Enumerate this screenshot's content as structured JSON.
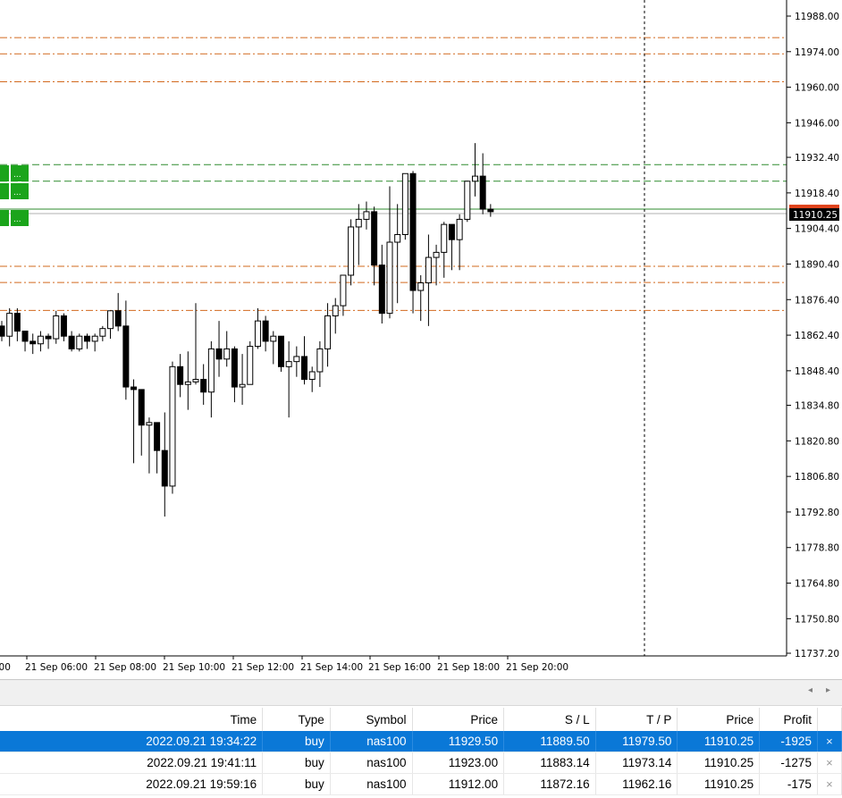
{
  "chart": {
    "price_axis": {
      "labels": [
        "11988.00",
        "11974.00",
        "11960.00",
        "11946.00",
        "11932.40",
        "11918.40",
        "11904.40",
        "11890.40",
        "11876.40",
        "11862.40",
        "11848.40",
        "11834.80",
        "11820.80",
        "11806.80",
        "11792.80",
        "11778.80",
        "11764.80",
        "11750.80",
        "11737.20"
      ],
      "min": 11737.2,
      "max": 11988.0
    },
    "time_axis": {
      "labels": [
        ":00",
        "21 Sep 06:00",
        "21 Sep 08:00",
        "21 Sep 10:00",
        "21 Sep 12:00",
        "21 Sep 14:00",
        "21 Sep 16:00",
        "21 Sep 18:00",
        "21 Sep 20:00"
      ]
    },
    "bid_price_tag": "11910.25",
    "bid_price": 11910.25,
    "entry_lines": [
      11929.5,
      11923.0,
      11912.0
    ],
    "sl_lines": [
      11889.5,
      11883.14,
      11872.16
    ],
    "tp_lines": [
      11979.5,
      11973.14,
      11962.16
    ],
    "colors": {
      "entry_line": "#2e8b2e",
      "stop_loss_line": "#d2691e",
      "take_profit_line": "#d2691e",
      "bid_tag_bg": "#000000",
      "bull_candle": "#ffffff",
      "bear_candle": "#000000",
      "trade_button": "#1ba41b",
      "selected_row": "#0a78d7"
    },
    "trade_buttons": [
      "...",
      "...",
      "..."
    ],
    "candles": [
      [
        11866,
        11868,
        11860,
        11862
      ],
      [
        11862,
        11873,
        11858,
        11871
      ],
      [
        11871,
        11873,
        11860,
        11864
      ],
      [
        11864,
        11864,
        11856,
        11860
      ],
      [
        11860,
        11863,
        11855,
        11859
      ],
      [
        11859,
        11864,
        11856,
        11862
      ],
      [
        11862,
        11863,
        11857,
        11861
      ],
      [
        11861,
        11872,
        11859,
        11870
      ],
      [
        11870,
        11871,
        11860,
        11862
      ],
      [
        11862,
        11864,
        11856,
        11857
      ],
      [
        11857,
        11863,
        11856,
        11862
      ],
      [
        11862,
        11863,
        11857,
        11860
      ],
      [
        11860,
        11863,
        11856,
        11862
      ],
      [
        11862,
        11866,
        11860,
        11865
      ],
      [
        11865,
        11872,
        11861,
        11872
      ],
      [
        11872,
        11879,
        11864,
        11866
      ],
      [
        11866,
        11876,
        11837,
        11842
      ],
      [
        11842,
        11845,
        11812,
        11841
      ],
      [
        11841,
        11841,
        11815,
        11827
      ],
      [
        11827,
        11830,
        11808,
        11828
      ],
      [
        11828,
        11828,
        11808,
        11817
      ],
      [
        11817,
        11832,
        11791,
        11803
      ],
      [
        11803,
        11852,
        11800,
        11850
      ],
      [
        11850,
        11855,
        11838,
        11843
      ],
      [
        11843,
        11856,
        11833,
        11844
      ],
      [
        11844,
        11875,
        11843,
        11845
      ],
      [
        11845,
        11851,
        11835,
        11840
      ],
      [
        11840,
        11860,
        11830,
        11857
      ],
      [
        11857,
        11868,
        11846,
        11853
      ],
      [
        11853,
        11864,
        11850,
        11857
      ],
      [
        11857,
        11858,
        11836,
        11842
      ],
      [
        11842,
        11855,
        11835,
        11843
      ],
      [
        11843,
        11860,
        11843,
        11858
      ],
      [
        11858,
        11873,
        11857,
        11868
      ],
      [
        11868,
        11870,
        11856,
        11860
      ],
      [
        11860,
        11864,
        11851,
        11862
      ],
      [
        11862,
        11862,
        11848,
        11850
      ],
      [
        11850,
        11860,
        11830,
        11852
      ],
      [
        11852,
        11858,
        11846,
        11854
      ],
      [
        11854,
        11862,
        11843,
        11845
      ],
      [
        11845,
        11850,
        11840,
        11848
      ],
      [
        11848,
        11860,
        11842,
        11857
      ],
      [
        11857,
        11875,
        11850,
        11870
      ],
      [
        11870,
        11877,
        11863,
        11874
      ],
      [
        11874,
        11885,
        11870,
        11886
      ],
      [
        11886,
        11908,
        11882,
        11905
      ],
      [
        11905,
        11914,
        11890,
        11908
      ],
      [
        11908,
        11915,
        11904,
        11911
      ],
      [
        11911,
        11913,
        11882,
        11890
      ],
      [
        11890,
        11898,
        11867,
        11871
      ],
      [
        11871,
        11921,
        11869,
        11899
      ],
      [
        11899,
        11914,
        11875,
        11902
      ],
      [
        11902,
        11920,
        11900,
        11926
      ],
      [
        11926,
        11927,
        11871,
        11880
      ],
      [
        11880,
        11886,
        11868,
        11883
      ],
      [
        11883,
        11902,
        11866,
        11893
      ],
      [
        11893,
        11898,
        11882,
        11895
      ],
      [
        11895,
        11907,
        11885,
        11906
      ],
      [
        11906,
        11904,
        11888,
        11900
      ],
      [
        11900,
        11910,
        11888,
        11908
      ],
      [
        11908,
        11923,
        11907,
        11923
      ],
      [
        11923,
        11938,
        11917,
        11925
      ],
      [
        11925,
        11934,
        11910,
        11912
      ],
      [
        11912,
        11914,
        11909,
        11911
      ]
    ]
  },
  "positions": {
    "headers": [
      "Time",
      "Type",
      "Symbol",
      "Price",
      "S / L",
      "T / P",
      "Price",
      "Profit",
      ""
    ],
    "rows": [
      {
        "time": "2022.09.21 19:34:22",
        "type": "buy",
        "symbol": "nas100",
        "price": "11929.50",
        "sl": "11889.50",
        "tp": "11979.50",
        "current": "11910.25",
        "profit": "-1925",
        "close": "×"
      },
      {
        "time": "2022.09.21 19:41:11",
        "type": "buy",
        "symbol": "nas100",
        "price": "11923.00",
        "sl": "11883.14",
        "tp": "11973.14",
        "current": "11910.25",
        "profit": "-1275",
        "close": "×"
      },
      {
        "time": "2022.09.21 19:59:16",
        "type": "buy",
        "symbol": "nas100",
        "price": "11912.00",
        "sl": "11872.16",
        "tp": "11962.16",
        "current": "11910.25",
        "profit": "-175",
        "close": "×"
      }
    ]
  },
  "scroll": {
    "left": "◂",
    "right": "▸"
  }
}
